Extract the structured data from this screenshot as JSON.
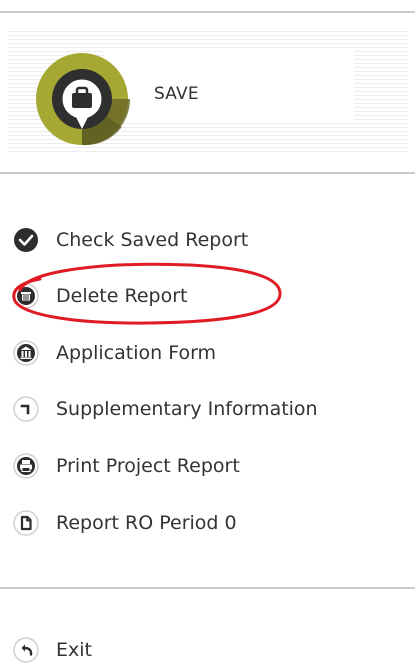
{
  "header": {
    "fragment_text": ""
  },
  "save_panel": {
    "label": "SAVE",
    "icon": "briefcase-icon",
    "colors": {
      "ring": "#a7a733",
      "ring_dark": "#6b6a28",
      "tile": "#2f2f2f"
    }
  },
  "menu": {
    "items": [
      {
        "key": "check-saved-report",
        "label": "Check Saved Report",
        "icon": "check-circle-icon"
      },
      {
        "key": "delete-report",
        "label": "Delete Report",
        "icon": "trash-icon"
      },
      {
        "key": "application-form",
        "label": "Application Form",
        "icon": "bank-icon"
      },
      {
        "key": "supplementary-information",
        "label": "Supplementary Information",
        "icon": "corner-arrow-icon"
      },
      {
        "key": "print-project-report",
        "label": "Print Project Report",
        "icon": "printer-icon"
      },
      {
        "key": "report-ro-period-0",
        "label": "Report RO Period 0",
        "icon": "document-icon"
      }
    ]
  },
  "exit": {
    "label": "Exit",
    "icon": "undo-arrow-icon"
  },
  "annotation": {
    "color": "#e01b24"
  }
}
